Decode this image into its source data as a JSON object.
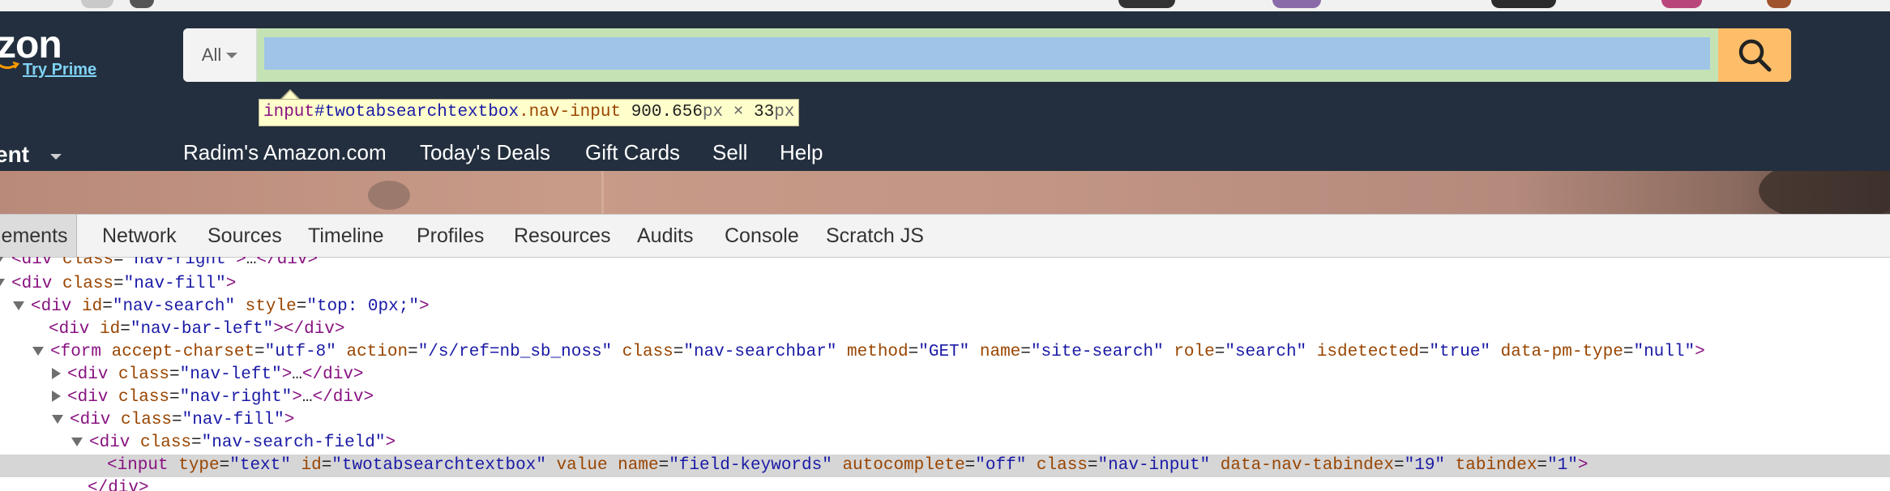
{
  "header": {
    "logo_text": "zon",
    "try_prime": "Try Prime",
    "search_scope": "All",
    "department_label": "ent",
    "nav_links": [
      "Radim's Amazon.com",
      "Today's Deals",
      "Gift Cards",
      "Sell",
      "Help"
    ]
  },
  "inspector_tooltip": {
    "tag": "input",
    "id": "#twotabsearchtextbox",
    "class": ".nav-input",
    "width": "900.656",
    "width_unit": "px",
    "times": "×",
    "height": "33",
    "height_unit": "px"
  },
  "devtools": {
    "tabs": [
      "lements",
      "Network",
      "Sources",
      "Timeline",
      "Profiles",
      "Resources",
      "Audits",
      "Console",
      "Scratch JS"
    ],
    "dom_lines": [
      {
        "indent": 0,
        "tri": "down",
        "open": "<div class=\"nav-right\">…</div>",
        "partial": true
      },
      {
        "indent": 0,
        "tri": "down",
        "open": "<div class=\"nav-fill\">"
      },
      {
        "indent": 1,
        "tri": "down",
        "open": "<div id=\"nav-search\" style=\"top: 0px;\">"
      },
      {
        "indent": 2,
        "tri": "none",
        "open": "<div id=\"nav-bar-left\"></div>"
      },
      {
        "indent": 2,
        "tri": "down",
        "open": "<form accept-charset=\"utf-8\" action=\"/s/ref=nb_sb_noss\" class=\"nav-searchbar\" method=\"GET\" name=\"site-search\" role=\"search\" isdetected=\"true\" data-pm-type=\"null\">"
      },
      {
        "indent": 3,
        "tri": "right",
        "open": "<div class=\"nav-left\">…</div>"
      },
      {
        "indent": 3,
        "tri": "right",
        "open": "<div class=\"nav-right\">…</div>"
      },
      {
        "indent": 3,
        "tri": "down",
        "open": "<div class=\"nav-fill\">"
      },
      {
        "indent": 4,
        "tri": "down",
        "open": "<div class=\"nav-search-field\">"
      },
      {
        "indent": 5,
        "tri": "none",
        "open": "<input type=\"text\" id=\"twotabsearchtextbox\" value name=\"field-keywords\" autocomplete=\"off\" class=\"nav-input\" data-nav-tabindex=\"19\" tabindex=\"1\">",
        "selected": true
      },
      {
        "indent": 4,
        "tri": "none",
        "open": "</div>"
      }
    ]
  },
  "colors": {
    "header_bg": "#232f3e",
    "search_button": "#febd69",
    "highlight_input": "#9fc4e8",
    "highlight_padding": "#c5e2b5",
    "tooltip_bg": "#ffffcc",
    "selected_row": "#d6d6d6"
  },
  "icons": {
    "search": "magnifier-icon",
    "scope_caret": "caret-down-icon"
  }
}
